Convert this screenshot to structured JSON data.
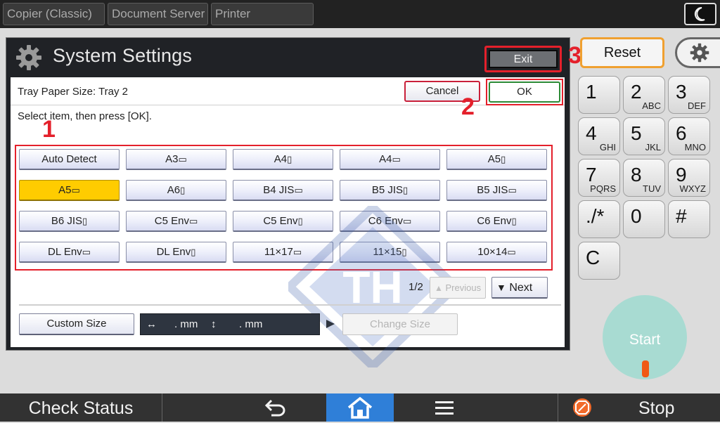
{
  "top_tabs": [
    {
      "label": "Copier (Classic)"
    },
    {
      "label": "Document Server"
    },
    {
      "label": "Printer"
    }
  ],
  "window": {
    "title": "System Settings",
    "exit_label": "Exit"
  },
  "dialog": {
    "breadcrumb": "Tray Paper Size: Tray 2",
    "cancel_label": "Cancel",
    "ok_label": "OK",
    "instruction": "Select item, then press [OK]."
  },
  "paper_sizes": [
    {
      "label": "Auto Detect",
      "selected": false
    },
    {
      "label": "A3",
      "selected": false
    },
    {
      "label": "A4",
      "selected": false
    },
    {
      "label": "A4",
      "selected": false
    },
    {
      "label": "A5",
      "selected": false
    },
    {
      "label": "A5",
      "selected": true
    },
    {
      "label": "A6",
      "selected": false
    },
    {
      "label": "B4 JIS",
      "selected": false
    },
    {
      "label": "B5 JIS",
      "selected": false
    },
    {
      "label": "B5 JIS",
      "selected": false
    },
    {
      "label": "B6 JIS",
      "selected": false
    },
    {
      "label": "C5 Env",
      "selected": false
    },
    {
      "label": "C5 Env",
      "selected": false
    },
    {
      "label": "C6 Env",
      "selected": false
    },
    {
      "label": "C6 Env",
      "selected": false
    },
    {
      "label": "DL Env",
      "selected": false
    },
    {
      "label": "DL Env",
      "selected": false
    },
    {
      "label": "11×17",
      "selected": false
    },
    {
      "label": "11×15",
      "selected": false
    },
    {
      "label": "10×14",
      "selected": false
    }
  ],
  "pager": {
    "count": "1/2",
    "previous_label": "Previous",
    "next_label": "Next"
  },
  "custom": {
    "custom_size_label": "Custom Size",
    "width_unit": ". mm",
    "height_unit": ". mm",
    "change_size_label": "Change Size"
  },
  "markers": {
    "one": "1",
    "two": "2",
    "three": "3"
  },
  "right_panel": {
    "reset_label": "Reset",
    "start_label": "Start"
  },
  "keypad": [
    {
      "main": "1",
      "sub": ""
    },
    {
      "main": "2",
      "sub": "ABC"
    },
    {
      "main": "3",
      "sub": "DEF"
    },
    {
      "main": "4",
      "sub": "GHI"
    },
    {
      "main": "5",
      "sub": "JKL"
    },
    {
      "main": "6",
      "sub": "MNO"
    },
    {
      "main": "7",
      "sub": "PQRS"
    },
    {
      "main": "8",
      "sub": "TUV"
    },
    {
      "main": "9",
      "sub": "WXYZ"
    },
    {
      "main": "./*",
      "sub": ""
    },
    {
      "main": "0",
      "sub": ""
    },
    {
      "main": "#",
      "sub": ""
    },
    {
      "main": "C",
      "sub": ""
    }
  ],
  "bottom_bar": {
    "check_status_label": "Check Status",
    "stop_label": "Stop"
  },
  "colors": {
    "highlight_red": "#e4202b",
    "selected_yellow": "#ffcc00",
    "home_blue": "#2f7fd8",
    "reset_orange": "#f0a030",
    "start_teal": "#a8dbd2"
  },
  "icons": [
    "moon-icon",
    "gear-icon",
    "back-arrow-icon",
    "home-icon",
    "menu-icon",
    "stop-icon",
    "watermark-logo"
  ]
}
